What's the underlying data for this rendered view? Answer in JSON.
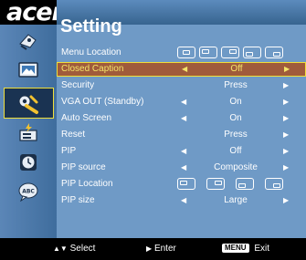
{
  "brand": {
    "logo_text": "acer"
  },
  "osd": {
    "title": "Setting",
    "rows": [
      {
        "label": "Menu Location",
        "type": "location",
        "boxes": 5
      },
      {
        "label": "Closed Caption",
        "value": "Off",
        "selected": true
      },
      {
        "label": "Security",
        "value": "Press",
        "arrows": "right"
      },
      {
        "label": "VGA OUT (Standby)",
        "value": "On",
        "arrows": "both"
      },
      {
        "label": "Auto Screen",
        "value": "On",
        "arrows": "both"
      },
      {
        "label": "Reset",
        "value": "Press",
        "arrows": "right"
      },
      {
        "label": "PIP",
        "value": "Off",
        "arrows": "both"
      },
      {
        "label": "PIP source",
        "value": "Composite",
        "arrows": "both"
      },
      {
        "label": "PIP Location",
        "type": "location",
        "boxes": 4
      },
      {
        "label": "PIP size",
        "value": "Large",
        "arrows": "both"
      }
    ]
  },
  "sidebar": {
    "icons": [
      "color-management-icon",
      "image-icon",
      "setting-icon",
      "management-icon",
      "timer-icon",
      "language-icon"
    ],
    "selected": "setting-icon"
  },
  "footer": {
    "select_hint": "Select",
    "enter_hint": "Enter",
    "menu_key": "MENU",
    "exit_hint": "Exit"
  },
  "colors": {
    "panel": "#6f9ac6",
    "sidebar": "#4a78a8",
    "selected_row": "#a05b3b",
    "highlight_border": "#f0df3a",
    "selected_text": "#f4e56a"
  }
}
